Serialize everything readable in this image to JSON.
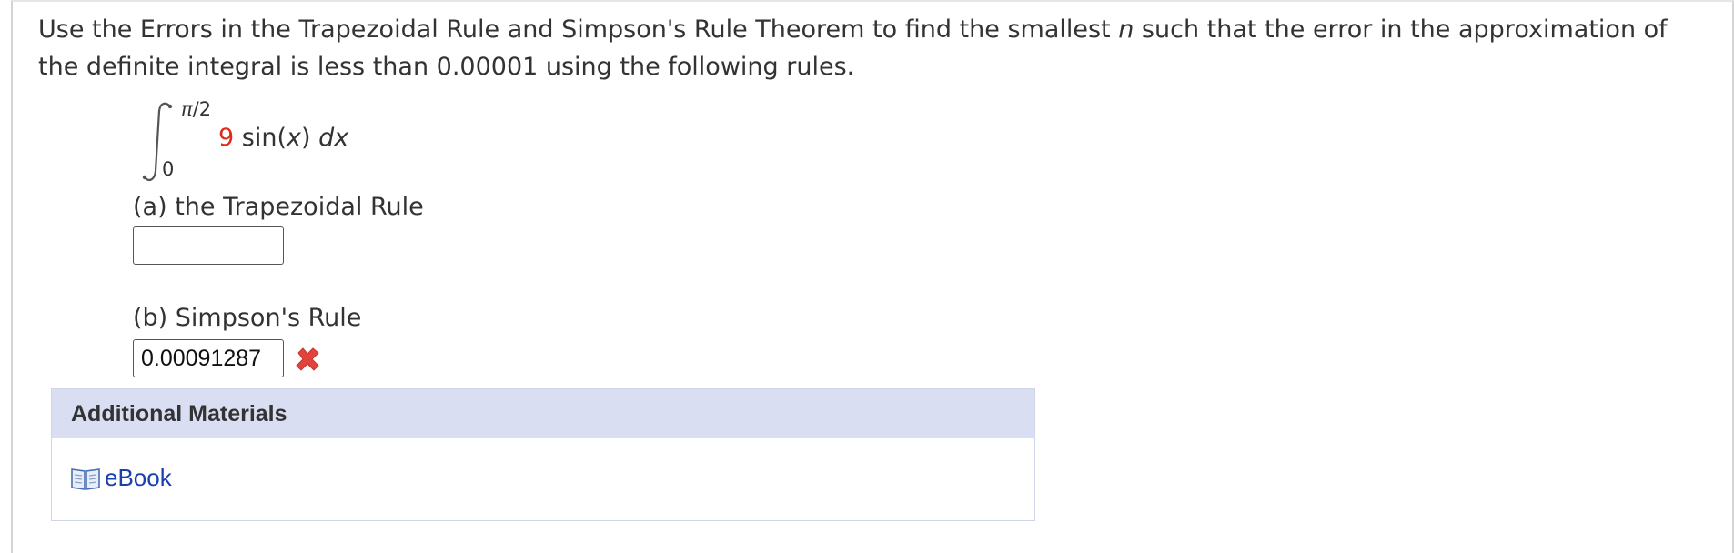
{
  "question": {
    "text_before_n": "Use the Errors in the Trapezoidal Rule and Simpson's Rule Theorem to find the smallest ",
    "n_symbol": "n",
    "text_after_n": " such that the error in the approximation of the definite integral is less than 0.00001 using the following rules."
  },
  "integral": {
    "upper_limit_pi": "π",
    "upper_limit_rest": "/2",
    "lower_limit": "0",
    "coefficient": "9",
    "function_prefix": " sin(",
    "variable": "x",
    "function_suffix": ") ",
    "differential": "dx",
    "coefficient_color": "#e02b1b"
  },
  "part_a": {
    "label": "(a) the Trapezoidal Rule",
    "answer_value": ""
  },
  "part_b": {
    "label": "(b) Simpson's Rule",
    "answer_value": "0.00091287",
    "status_icon": "incorrect-x-icon",
    "status_color": "#e0443c"
  },
  "additional_materials": {
    "header": "Additional Materials",
    "ebook_icon": "book-icon",
    "ebook_label": "eBook",
    "link_color": "#1a3fb0"
  }
}
